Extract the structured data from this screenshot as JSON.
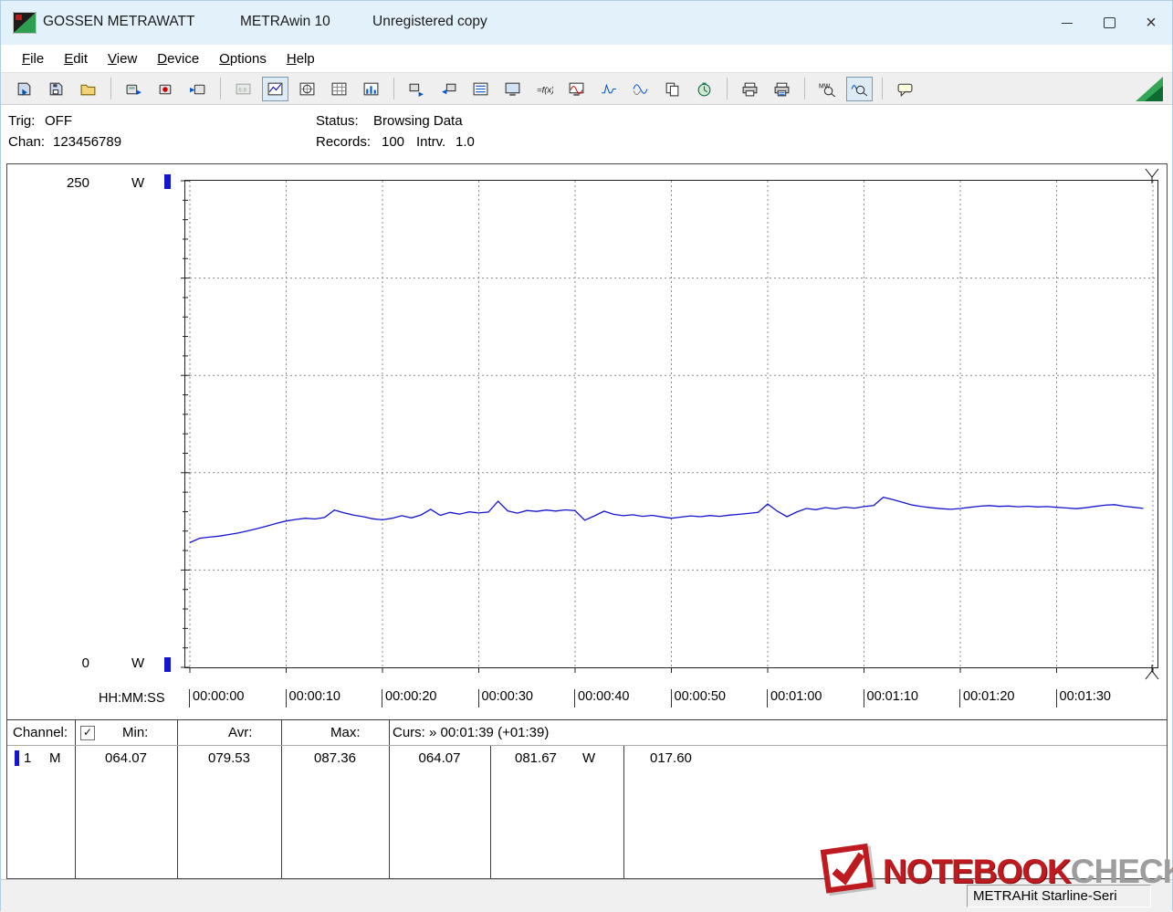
{
  "window": {
    "app_name": "GOSSEN METRAWATT",
    "title": "METRAwin 10",
    "subtitle": "Unregistered copy"
  },
  "menu": {
    "items": [
      "File",
      "Edit",
      "View",
      "Device",
      "Options",
      "Help"
    ]
  },
  "toolbar": {
    "buttons": [
      {
        "name": "open-file",
        "icon": "open-file"
      },
      {
        "name": "save-file",
        "icon": "save-file"
      },
      {
        "name": "open-folder",
        "icon": "open-folder"
      },
      {
        "sep": true
      },
      {
        "name": "card-export",
        "icon": "card-export"
      },
      {
        "name": "card-record",
        "icon": "card-record"
      },
      {
        "name": "card-import",
        "icon": "card-import"
      },
      {
        "sep": true
      },
      {
        "name": "view-multimeter",
        "icon": "multimeter",
        "disabled": true
      },
      {
        "name": "view-trend",
        "icon": "trend",
        "pressed": true
      },
      {
        "name": "view-scope",
        "icon": "scope"
      },
      {
        "name": "view-table",
        "icon": "table"
      },
      {
        "name": "view-bargraph",
        "icon": "bargraph"
      },
      {
        "sep": true
      },
      {
        "name": "transfer-out",
        "icon": "transfer-out"
      },
      {
        "name": "transfer-in",
        "icon": "transfer-in"
      },
      {
        "name": "view-list",
        "icon": "list-view"
      },
      {
        "name": "view-monitor",
        "icon": "monitor"
      },
      {
        "name": "formula",
        "icon": "formula"
      },
      {
        "name": "monitor-wave",
        "icon": "monitor-wave"
      },
      {
        "name": "signal-pulse",
        "icon": "pulse-min"
      },
      {
        "name": "signal-envelope",
        "icon": "pulse-env"
      },
      {
        "name": "copy-pages",
        "icon": "copy-pages"
      },
      {
        "name": "timer",
        "icon": "timer"
      },
      {
        "sep": true
      },
      {
        "name": "print",
        "icon": "print"
      },
      {
        "name": "print-report",
        "icon": "print-report"
      },
      {
        "sep": true
      },
      {
        "name": "zoom-value",
        "icon": "zoom-value"
      },
      {
        "name": "zoom-wave",
        "icon": "zoom-wave",
        "pressed": true
      },
      {
        "sep": true
      },
      {
        "name": "comment",
        "icon": "comment"
      }
    ]
  },
  "status_panel": {
    "trig_label": "Trig:",
    "trig_value": "OFF",
    "chan_label": "Chan:",
    "chan_value": "123456789",
    "status_label": "Status:",
    "status_value": "Browsing Data",
    "records_label": "Records:",
    "records_value": "100",
    "intrv_label": "Intrv.",
    "intrv_value": "1.0"
  },
  "chart_data": {
    "type": "line",
    "title": "",
    "unit": "W",
    "ylim": [
      0,
      250
    ],
    "y_axis": {
      "max_label": "250",
      "min_label": "0",
      "unit": "W"
    },
    "x_axis_label": "HH:MM:SS",
    "x_ticks": [
      "00:00:00",
      "00:00:10",
      "00:00:20",
      "00:00:30",
      "00:00:40",
      "00:00:50",
      "00:01:00",
      "00:01:10",
      "00:01:20",
      "00:01:30"
    ],
    "sample_interval_s": 1,
    "grid": true,
    "cursor": {
      "time": "00:01:39",
      "value": 81.67
    },
    "series": [
      {
        "name": "Channel 1",
        "color": "#1515cf",
        "values": [
          64.07,
          66.3,
          66.9,
          67.4,
          68.2,
          69.0,
          70.1,
          71.3,
          72.6,
          74.0,
          75.2,
          76.0,
          76.6,
          76.2,
          77.0,
          80.8,
          79.4,
          78.2,
          77.4,
          76.3,
          75.8,
          76.6,
          77.9,
          76.8,
          78.3,
          81.2,
          78.1,
          79.6,
          78.7,
          79.9,
          79.3,
          79.8,
          85.3,
          80.4,
          79.2,
          80.6,
          80.1,
          80.8,
          80.3,
          80.9,
          80.5,
          75.6,
          77.8,
          80.2,
          78.6,
          77.9,
          78.4,
          77.6,
          78.1,
          77.3,
          76.6,
          77.2,
          77.8,
          77.4,
          78.0,
          77.6,
          78.2,
          78.6,
          79.1,
          79.6,
          83.9,
          80.2,
          77.4,
          79.8,
          81.6,
          81.0,
          82.1,
          81.4,
          82.3,
          81.8,
          82.6,
          83.1,
          87.36,
          86.2,
          84.8,
          83.4,
          82.6,
          82.0,
          81.5,
          81.2,
          81.6,
          82.2,
          82.8,
          83.1,
          82.7,
          82.9,
          82.5,
          82.8,
          82.4,
          82.6,
          82.2,
          81.9,
          81.5,
          82.0,
          82.7,
          83.3,
          83.6,
          82.8,
          82.2,
          81.67
        ]
      }
    ]
  },
  "table": {
    "header": {
      "channel": "Channel:",
      "checkbox_checked": true,
      "min": "Min:",
      "avr": "Avr:",
      "max": "Max:",
      "curs": "Curs: » 00:01:39 (+01:39)"
    },
    "row": {
      "channel": "1",
      "mode": "M",
      "min": "064.07",
      "avr": "079.53",
      "max": "087.36",
      "curs_left": "064.07",
      "curs_right": "081.67",
      "unit": "W",
      "delta": "017.60"
    }
  },
  "statusbar": {
    "device_field": "METRAHit Starline-Seri"
  },
  "watermark": {
    "brand_red": "NOTEBOOK",
    "brand_gray": "CHECK"
  }
}
